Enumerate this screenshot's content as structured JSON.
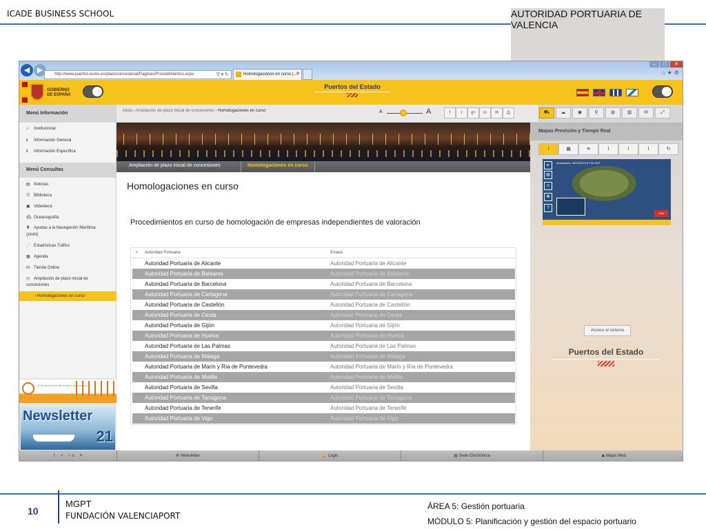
{
  "slide": {
    "header_left": "ICADE BUSINESS SCHOOL",
    "header_right": "AUTORIDAD PORTUARIA DE VALENCIA",
    "page_number": "10",
    "footer_title": "MGPT",
    "footer_subtitle": "FUNDACIÓN VALENCIAPORT",
    "area": "ÁREA 5: Gestión portuaria",
    "module": "MÓDULO 5: Planificación y gestión del espacio portuario"
  },
  "browser": {
    "url": "http://www.puertos.es/es-es/plazoconcesional/Paginas/Procedimientos.aspx",
    "tab_title": "Homologaciones en curso |...",
    "back_icon": "back-arrow-icon",
    "forward_icon": "forward-arrow-icon"
  },
  "site": {
    "gov_label": "GOBIERNO DE ESPAÑA",
    "title": "Puertos del Estado",
    "menu_info_title": "Menú Información",
    "menu_consult_title": "Menú Consultas",
    "breadcrumb_prefix": "Inicio › Ampliación de plazo inicial de concesiones ›",
    "breadcrumb_current": "Homologaciones en curso",
    "font_small": "A",
    "font_large": "A",
    "share": [
      "f",
      "t",
      "g+",
      "in",
      "✉",
      "⎙"
    ],
    "tools": [
      "⛟",
      "☁",
      "◉",
      "⚲",
      "◍",
      "▥",
      "✉",
      "⤢"
    ],
    "weather_title": "Mapas Previsión y Tiempo Real",
    "weather_tabs": [
      "i",
      "▦",
      "≋",
      "⌇",
      "⌇",
      "⌇",
      "↻"
    ],
    "map_label": "Actualizado: 06/04/2015 07:55 GMT",
    "map_info": "+Info",
    "map_date": "(06/04/201",
    "access_button": "Acceso al sistema",
    "colors": {
      "accent_yellow": "#f6c21c",
      "alt_row": "#a6a6a6",
      "link_blue": "#1f3f8f"
    }
  },
  "sidebar": {
    "info_items": [
      {
        "icon": "home-icon",
        "label": "Institucional"
      },
      {
        "icon": "info-icon",
        "label": "Información General"
      },
      {
        "icon": "info-icon",
        "label": "Información Específica"
      }
    ],
    "consult_items": [
      {
        "icon": "news-icon",
        "label": "Noticias"
      },
      {
        "icon": "library-icon",
        "label": "Biblioteca"
      },
      {
        "icon": "video-icon",
        "label": "Videoteca"
      },
      {
        "icon": "ship-icon",
        "label": "Oceanografía"
      },
      {
        "icon": "lighthouse-icon",
        "label": "Ayudas a la Navegación Marítima"
      },
      {
        "icon": "",
        "label": "(AtoN)"
      },
      {
        "icon": "chart-icon",
        "label": "Estadísticas Tráfico"
      },
      {
        "icon": "calendar-icon",
        "label": "Agenda"
      },
      {
        "icon": "shop-icon",
        "label": "Tienda Online"
      },
      {
        "icon": "clock-icon",
        "label": "Ampliación de plazo inicial de"
      },
      {
        "icon": "",
        "label": "concesiones"
      }
    ],
    "active_item": "Homologaciones en curso",
    "promo_newsletter": "Newsletter",
    "promo_number": "21",
    "promo_small_text": "2015 será el año del turismo de cruceros"
  },
  "content": {
    "subnav_left": "Ampliación de plazo inicial de concesiones",
    "subnav_active": "Homologaciones en curso",
    "page_title": "Homologaciones en curso",
    "section_title": "Procedimientos en curso de homologación de empresas independientes de valoración",
    "table": {
      "check": "✓",
      "col1": "Autoridad Portuaria",
      "col2": "Enlace",
      "rows": [
        [
          "Autoridad Portuaria de Alicante",
          "Autoridad Portuaria de Alicante"
        ],
        [
          "Autoridad Portuaria de Baleares",
          "Autoridad Portuaria de Baleares"
        ],
        [
          "Autoridad Portuaria de Barcelona",
          "Autoridad Portuaria de Barcelona"
        ],
        [
          "Autoridad Portuaria de Cartagena",
          "Autoridad Portuaria de Cartagena"
        ],
        [
          "Autoridad Portuaria de Castellón",
          "Autoridad Portuaria de Castellón"
        ],
        [
          "Autoridad Portuaria de Ceuta",
          "Autoridad Portuaria de Ceuta"
        ],
        [
          "Autoridad Portuaria de Gijón",
          "Autoridad Portuaria de Gijón"
        ],
        [
          "Autoridad Portuaria de Huelva",
          "Autoridad Portuaria de Huelva"
        ],
        [
          "Autoridad Portuaria de Las Palmas",
          "Autoridad Portuaria de Las Palmas"
        ],
        [
          "Autoridad Portuaria de Málaga",
          "Autoridad Portuaria de Málaga"
        ],
        [
          "Autoridad Portuaria de Marín y Ría de Pontevedra",
          "Autoridad Portuaria de Marín y Ría de Pontevedra"
        ],
        [
          "Autoridad Portuaria de Melilla",
          "Autoridad Portuaria de Melilla"
        ],
        [
          "Autoridad Portuaria de Sevilla",
          "Autoridad Portuaria de Sevilla"
        ],
        [
          "Autoridad Portuaria de Tarragona",
          "Autoridad Portuaria de Tarragona"
        ],
        [
          "Autoridad Portuaria de Tenerife",
          "Autoridad Portuaria de Tenerife"
        ],
        [
          "Autoridad Portuaria de Vigo",
          "Autoridad Portuaria de Vigo"
        ]
      ]
    }
  },
  "site_footer": {
    "social": "f ✓ in ✎",
    "newsletter": "✉ Newsletter",
    "login": "🔒 Login",
    "sede": "▤ Sede Electrónica",
    "mapa": "⛰ Mapa Web"
  }
}
